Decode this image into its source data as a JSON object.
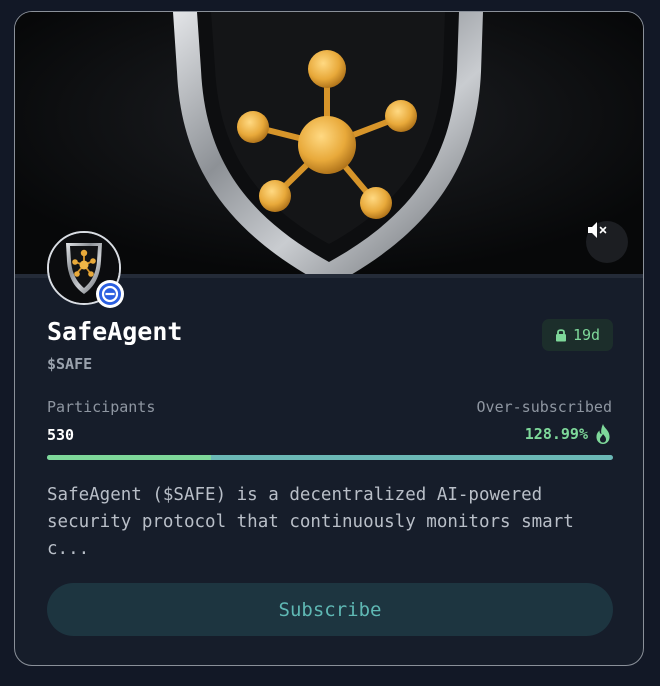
{
  "token": {
    "name": "SafeAgent",
    "ticker": "$SAFE",
    "lock_label": "19d",
    "description": "SafeAgent ($SAFE) is a decentralized AI-powered\nsecurity protocol that continuously monitors smart\nc..."
  },
  "stats": {
    "participants_label": "Participants",
    "participants_value": "530",
    "oversubscribed_label": "Over-subscribed",
    "oversubscribed_value": "128.99%",
    "progress_fraction": 0.29
  },
  "actions": {
    "subscribe_label": "Subscribe"
  },
  "icons": {
    "mute": "speaker-muted-icon",
    "lock": "lock-icon",
    "fire": "fire-icon",
    "chain": "chain-badge-icon"
  },
  "colors": {
    "accent_green": "#7ed89a",
    "accent_teal": "#5fb8b4",
    "card_bg": "#161d2a",
    "gold": "#e8a93a"
  }
}
